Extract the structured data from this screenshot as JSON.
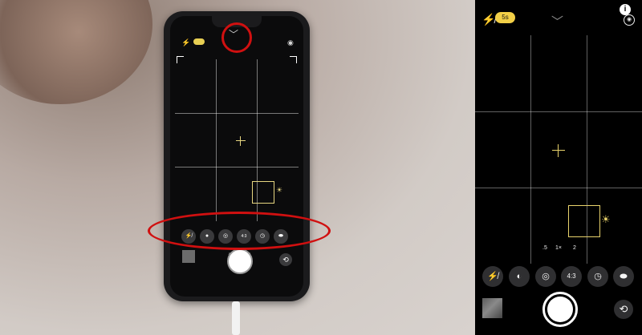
{
  "photo": {
    "night_label": "",
    "mini_zoom": [
      ".5",
      "1x",
      "2"
    ],
    "mini_controls": [
      "⚡̸",
      "●",
      "◎",
      "4:3",
      "◷",
      "⬬"
    ],
    "mini_shutter_label": ""
  },
  "camera": {
    "night_mode_label": "5s",
    "info_symbol": "i",
    "live_symbol": "◉",
    "chevron": "﹀",
    "zoom_levels": [
      ".5",
      "1×",
      "2"
    ],
    "controls": {
      "flash": "⚡̸",
      "live": "◐",
      "filters": "◎",
      "aspect": "4:3",
      "timer": "◷",
      "filters2": "⬬"
    },
    "switch_symbol": "⟲",
    "colors": {
      "accent": "#e9d36c",
      "night_pill": "#f2cf47",
      "annotation": "#d01010"
    }
  }
}
